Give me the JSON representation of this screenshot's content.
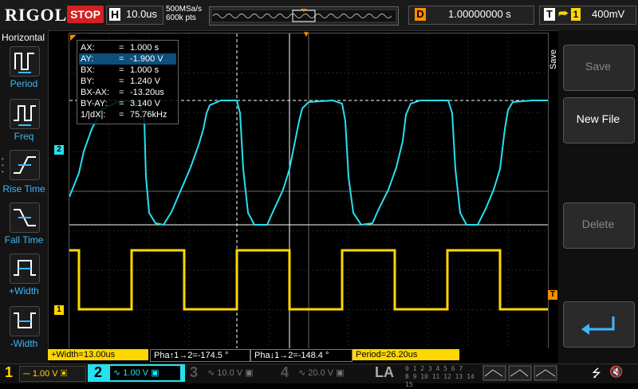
{
  "header": {
    "brand": "RIGOL",
    "run_state": "STOP",
    "timebase_letter": "H",
    "timebase": "10.0us",
    "sample_rate": "500MSa/s",
    "memory_depth": "600k pts",
    "delay_letter": "D",
    "delay": "1.00000000 s",
    "trigger_letter": "T",
    "trigger_source": "1",
    "trigger_level": "400mV"
  },
  "left_menu": {
    "title": "Horizontal",
    "items": [
      {
        "label": "Period",
        "icon": "period-icon"
      },
      {
        "label": "Freq",
        "icon": "freq-icon"
      },
      {
        "label": "Rise Time",
        "icon": "rise-time-icon"
      },
      {
        "label": "Fall Time",
        "icon": "fall-time-icon"
      },
      {
        "label": "+Width",
        "icon": "pos-width-icon"
      },
      {
        "label": "-Width",
        "icon": "neg-width-icon"
      }
    ]
  },
  "cursor_readout": [
    {
      "key": "AX:",
      "eq": "=",
      "value": "1.000 s"
    },
    {
      "key": "AY:",
      "eq": "=",
      "value": "-1.900 V"
    },
    {
      "key": "BX:",
      "eq": "=",
      "value": "1.000 s"
    },
    {
      "key": "BY:",
      "eq": "=",
      "value": "1.240 V"
    },
    {
      "key": "BX-AX:",
      "eq": "=",
      "value": "-13.20us"
    },
    {
      "key": "BY-AY:",
      "eq": "=",
      "value": "3.140 V"
    },
    {
      "key": "1/|dX|:",
      "eq": "=",
      "value": "75.76kHz"
    }
  ],
  "right_menu": {
    "tab": "Save",
    "buttons": [
      "Save",
      "New File",
      "Delete"
    ]
  },
  "measurements": [
    "+Width=13.00us",
    "Pha↑1→2=-174.5 °",
    "Pha↓1→2=-148.4 °",
    "Period=26.20us"
  ],
  "channels": [
    {
      "num": "1",
      "scale": "1.00 V",
      "color": "#ffd700"
    },
    {
      "num": "2",
      "scale": "1.00 V",
      "color": "#26e0f0"
    },
    {
      "num": "3",
      "scale": "10.0 V",
      "color": "#c050c0"
    },
    {
      "num": "4",
      "scale": "20.0 V",
      "color": "#2080ff"
    }
  ],
  "la": {
    "label": "LA",
    "rows": [
      "0 1 2 3  4 5 6 7",
      "8 9 10 11  12 13 14 15"
    ]
  },
  "markers": {
    "ch1": "1",
    "ch2": "2",
    "trigger": "T"
  },
  "colors": {
    "ch1": "#ffd700",
    "ch2": "#26e0f0",
    "accent": "#ff8c00",
    "menu_blue": "#3fb6ff"
  }
}
